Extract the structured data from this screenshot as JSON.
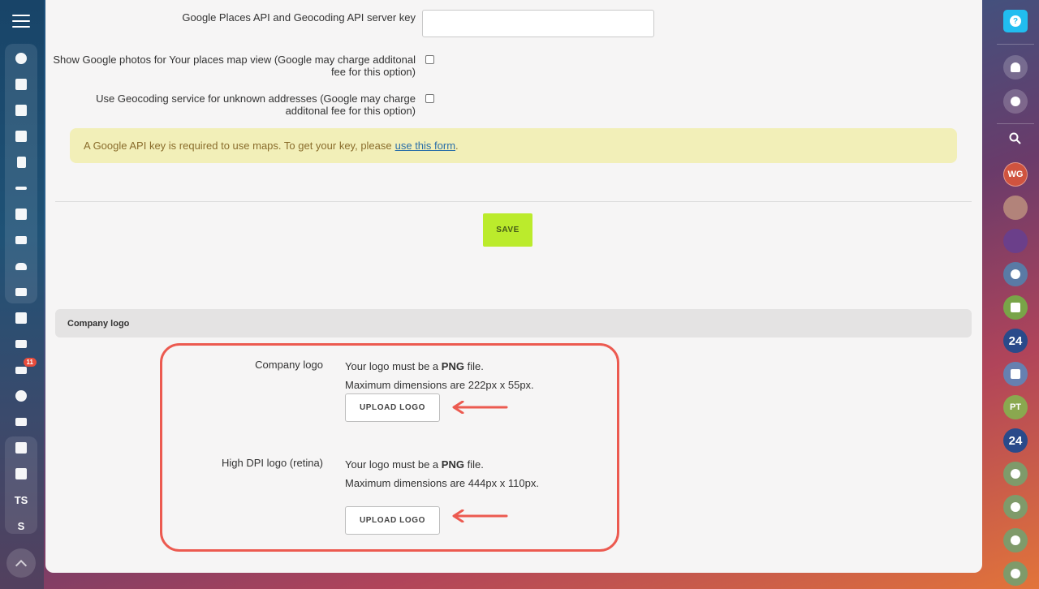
{
  "settings": {
    "places_key_label": "Google Places API and Geocoding API server key",
    "places_key_value": "",
    "photos_label_line1": "Show Google photos for Your places map view (Google may charge additonal",
    "photos_label_line2": "fee for this option)",
    "geocoding_label_line1": "Use Geocoding service for unknown addresses (Google may charge",
    "geocoding_label_line2": "additonal fee for this option)",
    "notice_text": "A Google API key is required to use maps. To get your key, please",
    "notice_link": "use this form",
    "notice_end": ".",
    "save_label": "SAVE"
  },
  "logo_section": {
    "title": "Company logo",
    "company_logo": {
      "label": "Company logo",
      "line1_prefix": "Your logo must be a",
      "line1_bold": "PNG",
      "line1_suffix": "file.",
      "line2": "Maximum dimensions are 222px x 55px.",
      "button": "UPLOAD LOGO"
    },
    "retina_logo": {
      "label": "High DPI logo (retina)",
      "line1_prefix": "Your logo must be a",
      "line1_bold": "PNG",
      "line1_suffix": "file.",
      "line2": "Maximum dimensions are 444px x 110px.",
      "button": "UPLOAD LOGO"
    }
  },
  "left_sidebar": {
    "badge_count": "11",
    "text_items": [
      "TS",
      "S"
    ]
  },
  "right_bar": {
    "avatar_initials": [
      "WG",
      "PT"
    ],
    "bitrix_label": "24"
  },
  "colors": {
    "save_button": "#bbeb2c",
    "highlight": "#ec5a50",
    "notice_bg": "#f2efb8",
    "help_button": "#21bdf0"
  }
}
